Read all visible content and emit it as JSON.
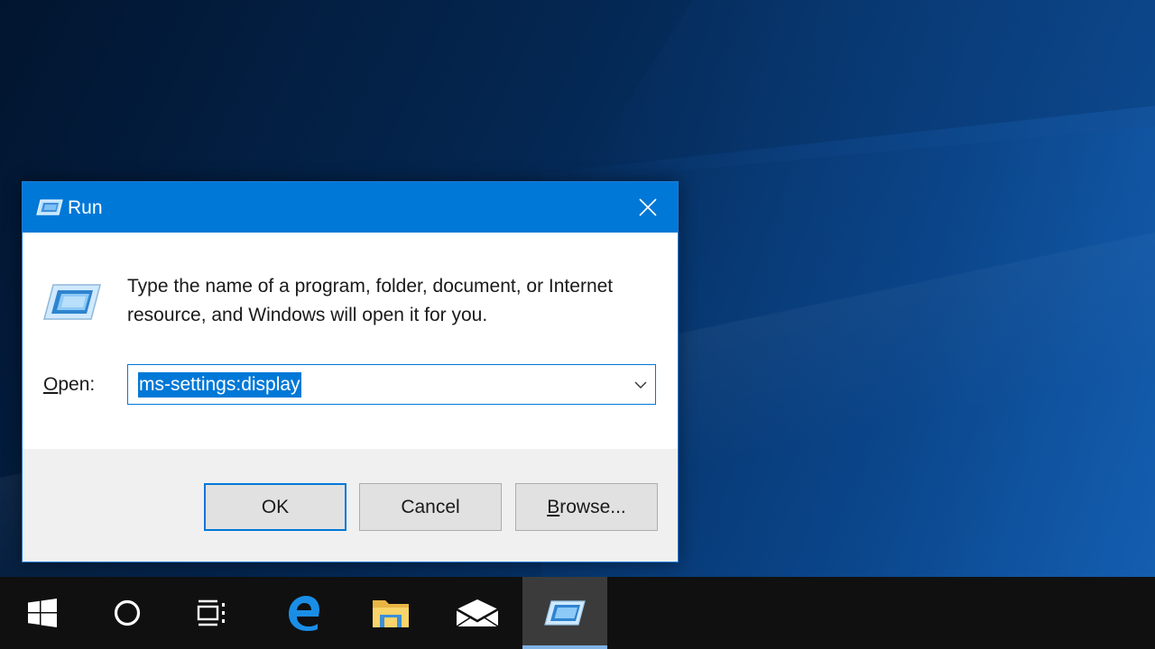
{
  "dialog": {
    "title": "Run",
    "description": "Type the name of a program, folder, document, or Internet resource, and Windows will open it for you.",
    "open_label_accel": "O",
    "open_label_rest": "pen:",
    "open_value": "ms-settings:display",
    "buttons": {
      "ok": "OK",
      "cancel": "Cancel",
      "browse_accel": "B",
      "browse_rest": "rowse..."
    }
  },
  "taskbar": {
    "items": [
      {
        "icon": "windows-start-icon"
      },
      {
        "icon": "cortana-search-icon"
      },
      {
        "icon": "task-view-icon"
      },
      {
        "icon": "edge-browser-icon"
      },
      {
        "icon": "file-explorer-icon"
      },
      {
        "icon": "mail-icon"
      },
      {
        "icon": "run-app-icon",
        "active": true
      }
    ]
  },
  "colors": {
    "accent": "#0078d7",
    "taskbar": "#101010",
    "dialog_footer": "#f0f0f0"
  }
}
